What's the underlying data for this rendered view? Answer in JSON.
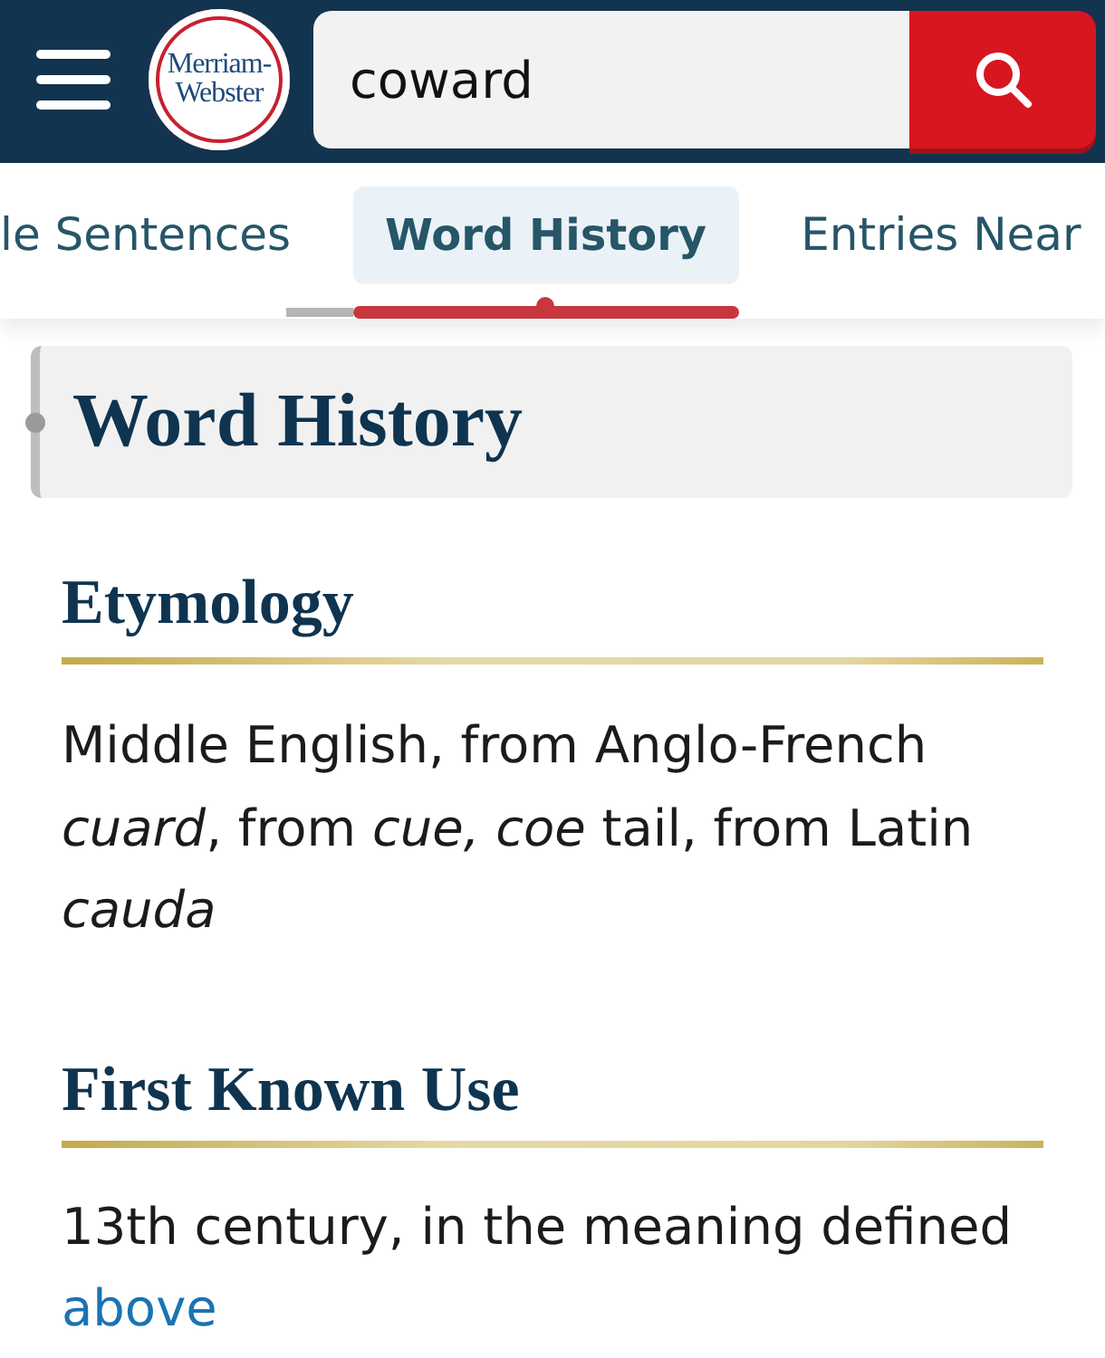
{
  "header": {
    "logo": {
      "lines": [
        "Merriam-",
        "Webster"
      ]
    },
    "search": {
      "value": "coward"
    }
  },
  "tabs": [
    {
      "label": "le Sentences",
      "selected": false
    },
    {
      "label": "Word History",
      "selected": true
    },
    {
      "label": "Entries Near",
      "selected": false
    }
  ],
  "section_title": "Word History",
  "sections": [
    {
      "heading": "Etymology",
      "text": "Middle English, from Anglo-French *cuard*, from *cue, coe* tail, from Latin *cauda*"
    },
    {
      "heading": "First Known Use",
      "text": "13th century, in the meaning defined",
      "link": "above"
    }
  ]
}
